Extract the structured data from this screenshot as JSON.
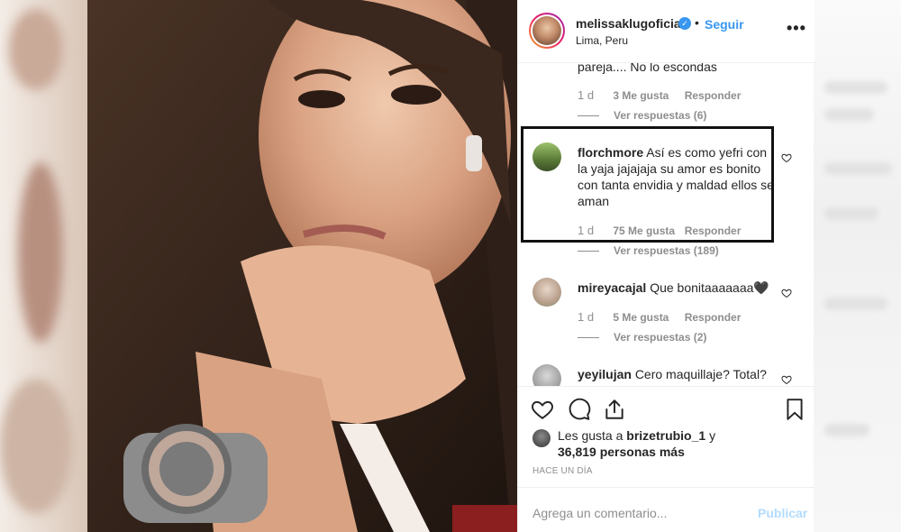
{
  "post": {
    "username": "melissaklugoficial",
    "dot": "•",
    "follow_label": "Seguir",
    "location": "Lima, Peru",
    "more": "•••"
  },
  "comments": [
    {
      "text": "pareja.... No lo escondas",
      "time": "1 d",
      "likes": "3 Me gusta",
      "reply": "Responder",
      "view_replies": "Ver respuestas (6)"
    },
    {
      "user": "florchmore",
      "text": "Así es como yefri con la yaja jajajaja su amor es bonito con tanta envidia y maldad ellos se aman",
      "time": "1 d",
      "likes": "75 Me gusta",
      "reply": "Responder",
      "view_replies": "Ver respuestas (189)"
    },
    {
      "user": "mireyacajal",
      "text": "Que bonitaaaaaaa🖤",
      "time": "1 d",
      "likes": "5 Me gusta",
      "reply": "Responder",
      "view_replies": "Ver respuestas (2)"
    },
    {
      "user": "yeyilujan",
      "text": "Cero maquillaje? Total?"
    }
  ],
  "likes": {
    "prefix": "Les gusta a ",
    "user": "brizetrubio_1",
    "suffix": " y",
    "count": "36,819 personas más"
  },
  "time_ago": "HACE UN DÍA",
  "add_comment": {
    "placeholder": "Agrega un comentario...",
    "publish": "Publicar"
  },
  "colors": {
    "accent": "#3897f0",
    "muted": "#8e8e8e",
    "text": "#262626",
    "publish_disabled": "#b3dbff"
  }
}
